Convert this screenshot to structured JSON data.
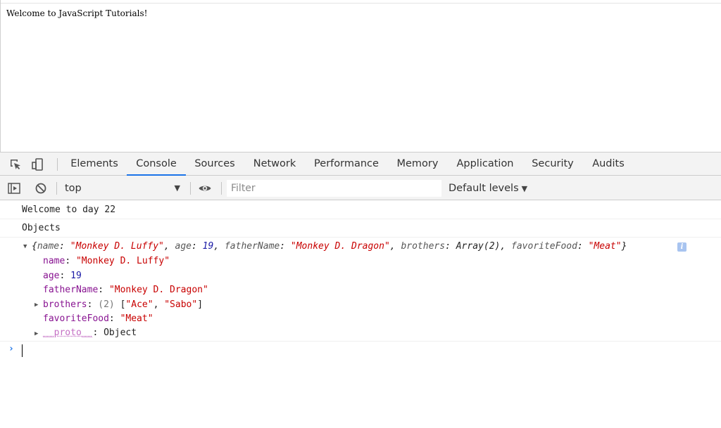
{
  "page": {
    "text": "Welcome to JavaScript Tutorials!"
  },
  "devtools": {
    "tabs": [
      {
        "label": "Elements",
        "active": false
      },
      {
        "label": "Console",
        "active": true
      },
      {
        "label": "Sources",
        "active": false
      },
      {
        "label": "Network",
        "active": false
      },
      {
        "label": "Performance",
        "active": false
      },
      {
        "label": "Memory",
        "active": false
      },
      {
        "label": "Application",
        "active": false
      },
      {
        "label": "Security",
        "active": false
      },
      {
        "label": "Audits",
        "active": false
      }
    ],
    "toolbar": {
      "context": "top",
      "filter_placeholder": "Filter",
      "levels": "Default levels"
    },
    "accent": "#1a73e8"
  },
  "console": {
    "logs": [
      "Welcome to day 22",
      "Objects"
    ],
    "object": {
      "summary": {
        "open": "{",
        "name_key": "name",
        "name_val": "\"Monkey D. Luffy\"",
        "age_key": "age",
        "age_val": "19",
        "father_key": "fatherName",
        "father_val": "\"Monkey D. Dragon\"",
        "brothers_key": "brothers",
        "brothers_val": "Array(2)",
        "food_key": "favoriteFood",
        "food_val": "\"Meat\"",
        "close": "}"
      },
      "props": {
        "name_key": "name",
        "name_val": "\"Monkey D. Luffy\"",
        "age_key": "age",
        "age_val": "19",
        "father_key": "fatherName",
        "father_val": "\"Monkey D. Dragon\"",
        "brothers_key": "brothers",
        "brothers_count": "(2)",
        "brothers_open": "[",
        "brother1": "\"Ace\"",
        "brother2": "\"Sabo\"",
        "brothers_close": "]",
        "food_key": "favoriteFood",
        "food_val": "\"Meat\"",
        "proto_key": "__proto__",
        "proto_val": "Object"
      },
      "info_badge": "i"
    },
    "prompt": "›"
  }
}
